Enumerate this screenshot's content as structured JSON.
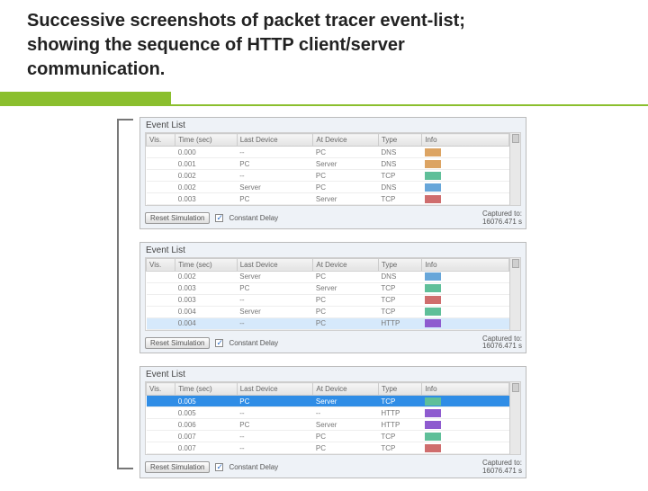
{
  "title_line1": "Successive screenshots of packet tracer event-list;",
  "title_line2": "showing the sequence of HTTP client/server",
  "title_line3": "communication.",
  "panel_heading": "Event List",
  "columns": {
    "vis": "Vis.",
    "time": "Time (sec)",
    "last": "Last Device",
    "at": "At Device",
    "type": "Type",
    "info": "Info"
  },
  "reset_label": "Reset Simulation",
  "constant_delay_label": "Constant Delay",
  "captured_label": "Captured to:",
  "captured_value": "16076.471 s",
  "panels": [
    {
      "rows": [
        {
          "time": "0.000",
          "last": "--",
          "at": "PC",
          "type": "DNS",
          "color": "#dca463"
        },
        {
          "time": "0.001",
          "last": "PC",
          "at": "Server",
          "type": "DNS",
          "color": "#dca463"
        },
        {
          "time": "0.002",
          "last": "--",
          "at": "PC",
          "type": "TCP",
          "color": "#5fbf99"
        },
        {
          "time": "0.002",
          "last": "Server",
          "at": "PC",
          "type": "DNS",
          "color": "#67a6d9"
        },
        {
          "time": "0.003",
          "last": "PC",
          "at": "Server",
          "type": "TCP",
          "color": "#cf6d6d"
        }
      ],
      "highlight": -1
    },
    {
      "rows": [
        {
          "time": "0.002",
          "last": "Server",
          "at": "PC",
          "type": "DNS",
          "color": "#67a6d9"
        },
        {
          "time": "0.003",
          "last": "PC",
          "at": "Server",
          "type": "TCP",
          "color": "#5fbf99"
        },
        {
          "time": "0.003",
          "last": "--",
          "at": "PC",
          "type": "TCP",
          "color": "#cf6d6d"
        },
        {
          "time": "0.004",
          "last": "Server",
          "at": "PC",
          "type": "TCP",
          "color": "#5fbf99"
        },
        {
          "time": "0.004",
          "last": "--",
          "at": "PC",
          "type": "HTTP",
          "color": "#8e5bcf"
        }
      ],
      "highlight": -1,
      "soft_highlight": 4
    },
    {
      "rows": [
        {
          "time": "0.005",
          "last": "PC",
          "at": "Server",
          "type": "TCP",
          "color": "#5fbf99"
        },
        {
          "time": "0.005",
          "last": "--",
          "at": "--",
          "type": "HTTP",
          "color": "#8e5bcf"
        },
        {
          "time": "0.006",
          "last": "PC",
          "at": "Server",
          "type": "HTTP",
          "color": "#8e5bcf"
        },
        {
          "time": "0.007",
          "last": "--",
          "at": "PC",
          "type": "TCP",
          "color": "#5fbf99"
        },
        {
          "time": "0.007",
          "last": "--",
          "at": "PC",
          "type": "TCP",
          "color": "#cf6d6d"
        }
      ],
      "highlight": 0
    }
  ]
}
